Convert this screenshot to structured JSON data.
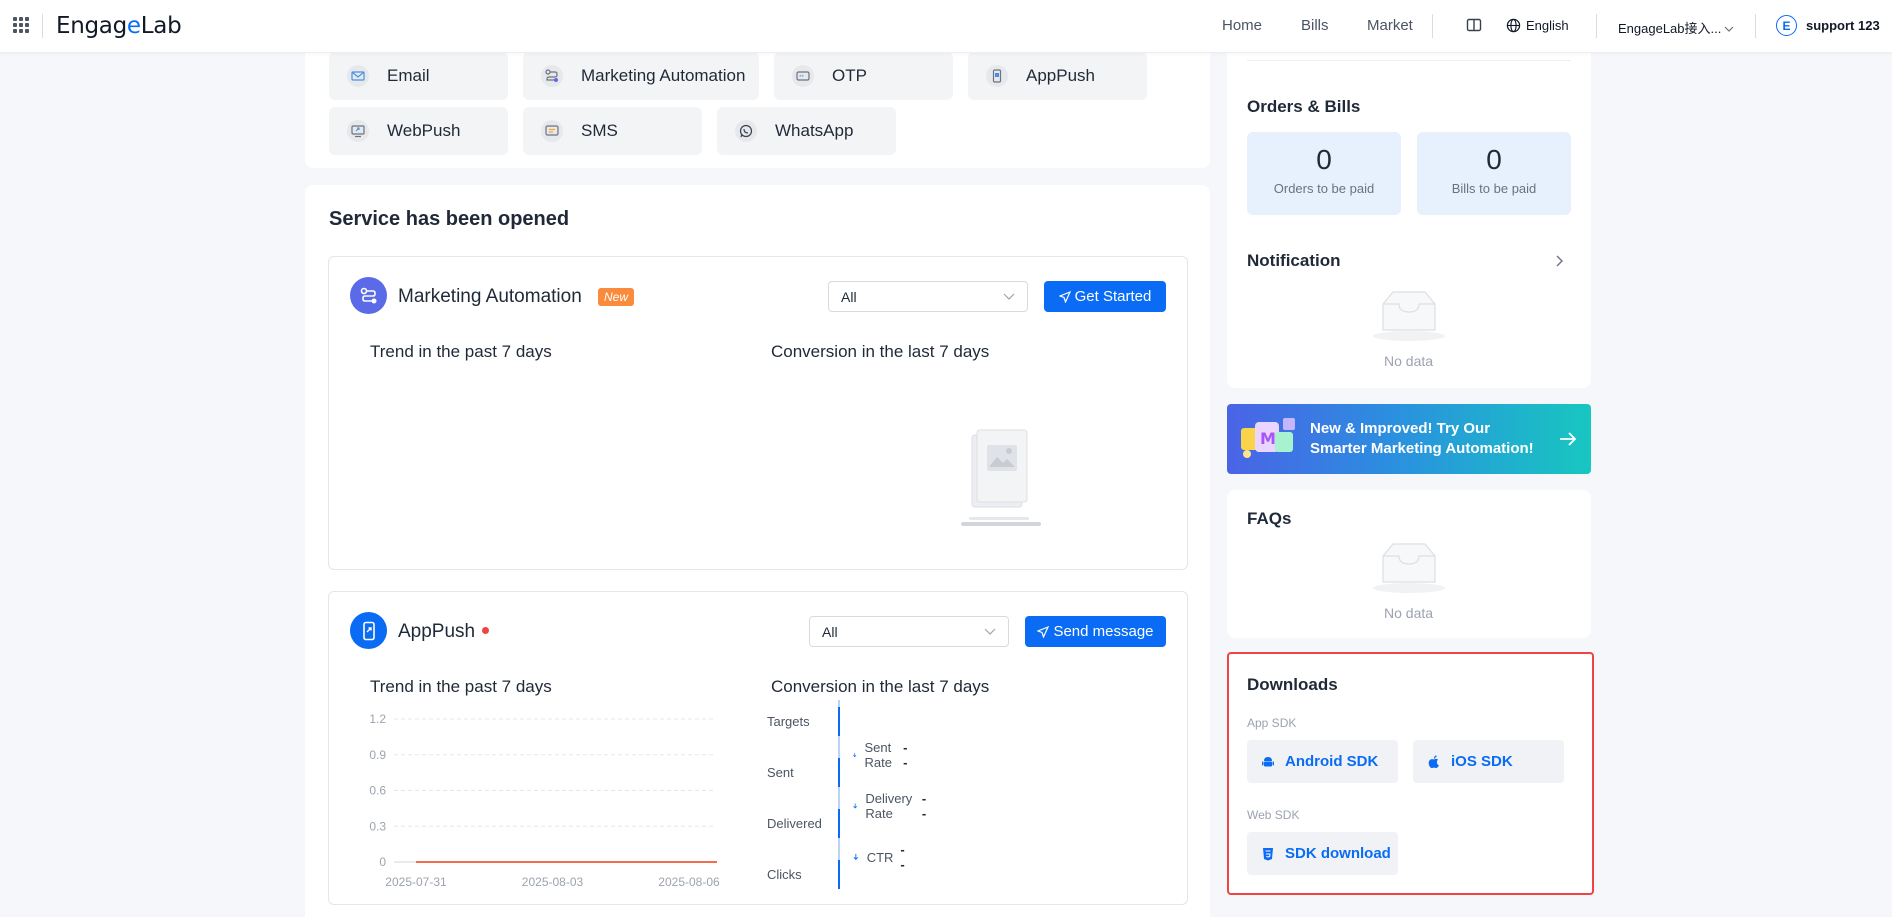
{
  "header": {
    "logo_part1": "Engag",
    "logo_part2": "e",
    "logo_part3": "Lab",
    "nav": [
      "Home",
      "Bills",
      "Market"
    ],
    "language": "English",
    "workspace": "EngageLab接入...",
    "avatar_letter": "E",
    "username": "support 123"
  },
  "products": [
    {
      "label": "Email",
      "icon": "mail-icon"
    },
    {
      "label": "Marketing Automation",
      "icon": "flow-icon"
    },
    {
      "label": "OTP",
      "icon": "otp-icon"
    },
    {
      "label": "AppPush",
      "icon": "phone-icon"
    },
    {
      "label": "WebPush",
      "icon": "monitor-icon"
    },
    {
      "label": "SMS",
      "icon": "sms-icon"
    },
    {
      "label": "WhatsApp",
      "icon": "whatsapp-icon"
    }
  ],
  "services_title": "Service has been opened",
  "marketing": {
    "name": "Marketing Automation",
    "badge": "New",
    "select_value": "All",
    "button": "Get Started",
    "trend_title": "Trend in the past 7 days",
    "conversion_title": "Conversion in the last 7 days"
  },
  "apppush": {
    "name": "AppPush",
    "select_value": "All",
    "button": "Send message",
    "trend_title": "Trend in the past 7 days",
    "conversion_title": "Conversion in the last 7 days",
    "funnel_stages": [
      "Targets",
      "Sent",
      "Delivered",
      "Clicks"
    ],
    "funnel_rates": [
      {
        "label": "Sent Rate",
        "value": "--"
      },
      {
        "label": "Delivery Rate",
        "value": "--"
      },
      {
        "label": "CTR",
        "value": "--"
      }
    ]
  },
  "chart_data": {
    "type": "line",
    "x": [
      "2025-07-31",
      "2025-08-03",
      "2025-08-06"
    ],
    "yticks": [
      "1.2",
      "0.9",
      "0.6",
      "0.3",
      "0"
    ],
    "ylim": [
      0,
      1.2
    ],
    "series": [
      {
        "values": [
          0,
          0,
          0
        ],
        "color": "#f26d4f"
      }
    ],
    "grid": true
  },
  "right": {
    "orders_title": "Orders & Bills",
    "orders_count": "0",
    "orders_label": "Orders to be paid",
    "bills_count": "0",
    "bills_label": "Bills to be paid",
    "notification_title": "Notification",
    "notification_empty": "No data",
    "banner_text": "New & Improved! Try Our Smarter Marketing Automation!",
    "faqs_title": "FAQs",
    "faqs_empty": "No data",
    "downloads_title": "Downloads",
    "app_sdk_label": "App SDK",
    "android_sdk": "Android SDK",
    "ios_sdk": "iOS SDK",
    "web_sdk_label": "Web SDK",
    "sdk_download": "SDK download"
  },
  "colors": {
    "primary": "#0a6cf5",
    "accent_orange": "#fb8b3c",
    "highlight_red": "#ef4444"
  }
}
